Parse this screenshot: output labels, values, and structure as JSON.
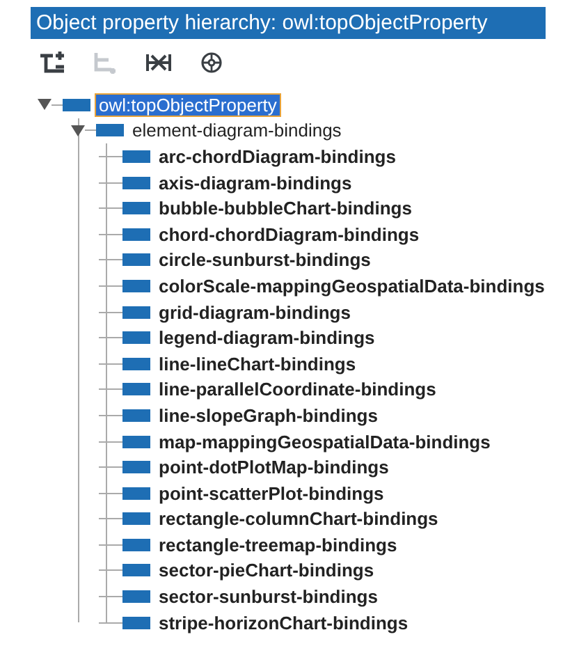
{
  "window": {
    "title": "Object property hierarchy: owl:topObjectProperty"
  },
  "toolbar": [
    {
      "kind": "add-sub",
      "disabled": false
    },
    {
      "kind": "add-sibling",
      "disabled": true
    },
    {
      "kind": "delete",
      "disabled": false
    },
    {
      "kind": "gear",
      "disabled": false
    }
  ],
  "tree": [
    {
      "label": "owl:topObjectProperty",
      "selected": true,
      "expanded": true,
      "children": [
        {
          "label": "element-diagram-bindings",
          "selected": false,
          "expanded": true,
          "children": [
            {
              "label": "arc-chordDiagram-bindings",
              "selected": false
            },
            {
              "label": "axis-diagram-bindings",
              "selected": false
            },
            {
              "label": "bubble-bubbleChart-bindings",
              "selected": false
            },
            {
              "label": "chord-chordDiagram-bindings",
              "selected": false
            },
            {
              "label": "circle-sunburst-bindings",
              "selected": false
            },
            {
              "label": "colorScale-mappingGeospatialData-bindings",
              "selected": false
            },
            {
              "label": "grid-diagram-bindings",
              "selected": false
            },
            {
              "label": "legend-diagram-bindings",
              "selected": false
            },
            {
              "label": "line-lineChart-bindings",
              "selected": false
            },
            {
              "label": "line-parallelCoordinate-bindings",
              "selected": false
            },
            {
              "label": "line-slopeGraph-bindings",
              "selected": false
            },
            {
              "label": "map-mappingGeospatialData-bindings",
              "selected": false
            },
            {
              "label": "point-dotPlotMap-bindings",
              "selected": false
            },
            {
              "label": "point-scatterPlot-bindings",
              "selected": false
            },
            {
              "label": "rectangle-columnChart-bindings",
              "selected": false
            },
            {
              "label": "rectangle-treemap-bindings",
              "selected": false
            },
            {
              "label": "sector-pieChart-bindings",
              "selected": false
            },
            {
              "label": "sector-sunburst-bindings",
              "selected": false
            },
            {
              "label": "stripe-horizonChart-bindings",
              "selected": false
            }
          ]
        }
      ]
    }
  ]
}
